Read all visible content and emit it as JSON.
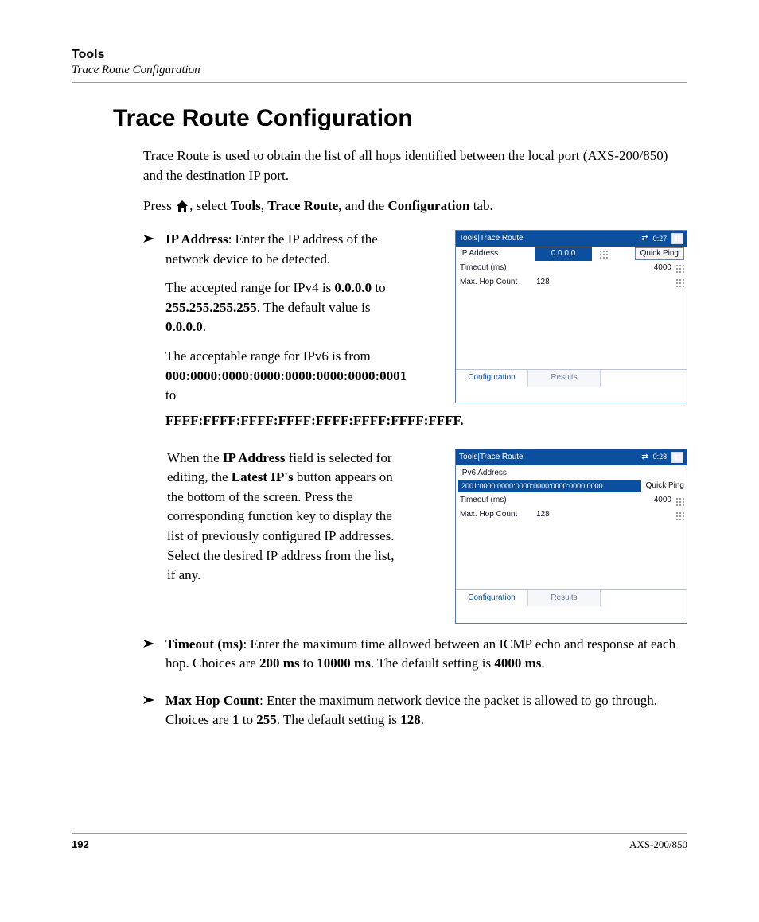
{
  "header": {
    "section": "Tools",
    "subsection": "Trace Route Configuration"
  },
  "title": "Trace Route Configuration",
  "intro": "Trace Route is used to obtain the list of all hops identified between the local port (AXS-200/850) and the destination IP port.",
  "press": {
    "pre": "Press ",
    "mid1": ", select ",
    "tools": "Tools",
    "sep1": ", ",
    "trace": "Trace Route",
    "mid2": ", and the ",
    "config": "Configuration",
    "post": " tab."
  },
  "ip": {
    "label": "IP Address",
    "desc": ": Enter the IP address of the network device to be detected.",
    "v4_intro": "The accepted range for IPv4 is ",
    "v4_from": "0.0.0.0",
    "v4_to_word": " to ",
    "v4_to": "255.255.255.255",
    "v4_tail": ". The default value is ",
    "v4_default": "0.0.0.0",
    "v4_period": ".",
    "v6_intro": "The acceptable range for IPv6 is from",
    "v6_from": "000:0000:0000:0000:0000:0000:0000:0001",
    "v6_to_word": " to ",
    "v6_to": "FFFF:FFFF:FFFF:FFFF:FFFF:FFFF:FFFF:FFFF."
  },
  "latest": {
    "p1a": "When the ",
    "p1b": "IP Address",
    "p1c": " field is selected for editing, the ",
    "p1d": "Latest IP's",
    "p1e": " button appears on the bottom of the screen. Press the corresponding function key to display the list of previously configured IP addresses. Select the desired IP address from the list, if any."
  },
  "timeout": {
    "label": "Timeout (ms)",
    "desc": ": Enter the maximum time allowed between an ICMP echo and response at each hop. Choices are ",
    "from": "200 ms",
    "to_word": " to ",
    "to": "10000 ms",
    "tail": ". The default setting is ",
    "default": "4000 ms",
    "period": "."
  },
  "maxhop": {
    "label": "Max Hop Count",
    "desc": ": Enter the maximum network device the packet is allowed to go through. Choices are ",
    "from": "1",
    "to_word": " to ",
    "to": "255",
    "tail": ". The default setting is ",
    "default": "128",
    "period": "."
  },
  "shot1": {
    "title": "Tools|Trace Route",
    "time": "0:27",
    "row_ip_label": "IP Address",
    "row_ip_value": "0.0.0.0",
    "quick_ping": "Quick Ping",
    "row_timeout_label": "Timeout (ms)",
    "row_timeout_value": "4000",
    "row_hop_label": "Max. Hop Count",
    "row_hop_value": "128",
    "tab_config": "Configuration",
    "tab_results": "Results"
  },
  "shot2": {
    "title": "Tools|Trace Route",
    "time": "0:28",
    "ipv6_label": "IPv6 Address",
    "ipv6_value": "2001:0000:0000:0000:0000:0000:0000:0000",
    "quick_ping": "Quick Ping",
    "row_timeout_label": "Timeout (ms)",
    "row_timeout_value": "4000",
    "row_hop_label": "Max. Hop Count",
    "row_hop_value": "128",
    "tab_config": "Configuration",
    "tab_results": "Results"
  },
  "footer": {
    "page": "192",
    "model": "AXS-200/850"
  }
}
